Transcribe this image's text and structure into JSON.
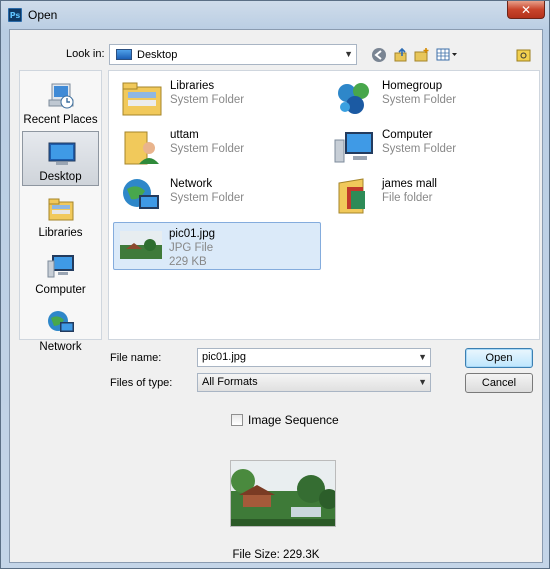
{
  "window": {
    "title": "Open",
    "app_badge": "Ps",
    "close_glyph": "✕"
  },
  "lookin": {
    "label": "Look in:",
    "value": "Desktop"
  },
  "toolbar_icons": [
    "back-icon",
    "up-folder-icon",
    "new-folder-icon",
    "view-menu-icon"
  ],
  "places": [
    {
      "label": "Recent Places",
      "icon": "recent-places-icon"
    },
    {
      "label": "Desktop",
      "icon": "desktop-icon",
      "selected": true
    },
    {
      "label": "Libraries",
      "icon": "libraries-icon"
    },
    {
      "label": "Computer",
      "icon": "computer-icon"
    },
    {
      "label": "Network",
      "icon": "network-icon"
    }
  ],
  "files": [
    {
      "name": "Libraries",
      "type": "System Folder",
      "icon": "libraries-folder-icon"
    },
    {
      "name": "Homegroup",
      "type": "System Folder",
      "icon": "homegroup-icon"
    },
    {
      "name": "uttam",
      "type": "System Folder",
      "icon": "user-folder-icon"
    },
    {
      "name": "Computer",
      "type": "System Folder",
      "icon": "computer-icon"
    },
    {
      "name": "Network",
      "type": "System Folder",
      "icon": "network-icon"
    },
    {
      "name": "james mall",
      "type": "File folder",
      "icon": "folder-icon"
    },
    {
      "name": "pic01.jpg",
      "type": "JPG File",
      "size": "229 KB",
      "icon": "image-thumbnail",
      "selected": true
    }
  ],
  "filename": {
    "label": "File name:",
    "value": "pic01.jpg"
  },
  "filetype": {
    "label": "Files of type:",
    "value": "All Formats"
  },
  "buttons": {
    "open": "Open",
    "cancel": "Cancel"
  },
  "image_sequence": {
    "label": "Image Sequence",
    "checked": false
  },
  "preview": {
    "file_size": "File Size: 229.3K"
  },
  "colors": {
    "selection": "#dbeaf9",
    "selection_border": "#84acdd",
    "client_bg": "#f0f0f0"
  }
}
